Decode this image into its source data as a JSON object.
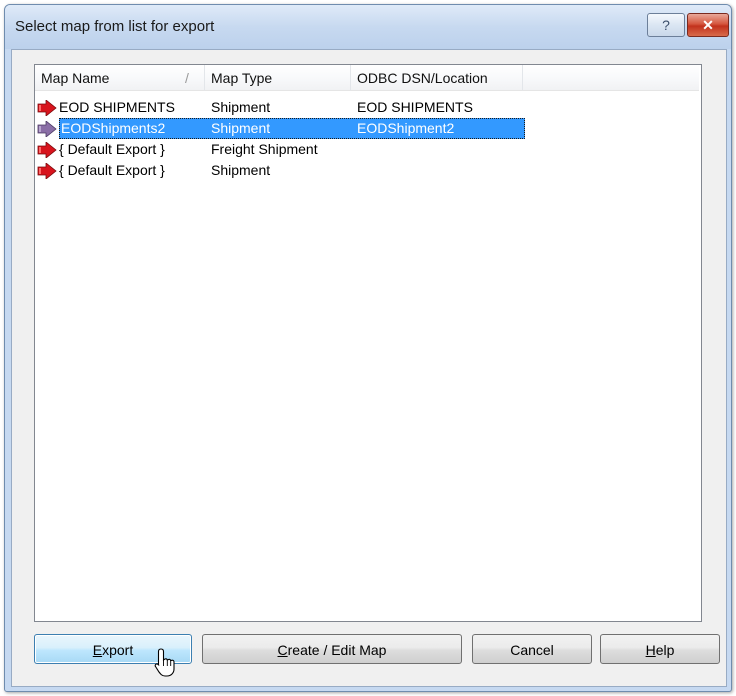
{
  "window": {
    "title": "Select map from list for export",
    "help_glyph": "?",
    "close_glyph": "✕"
  },
  "list": {
    "columns": [
      "Map Name",
      "Map Type",
      "ODBC DSN/Location"
    ],
    "sort_indicator": "/",
    "rows": [
      {
        "name": "EOD SHIPMENTS",
        "type": "Shipment",
        "location": "EOD SHIPMENTS",
        "selected": false,
        "icon": "red-export-arrow-icon"
      },
      {
        "name": "EODShipments2",
        "type": "Shipment",
        "location": "EODShipment2",
        "selected": true,
        "icon": "red-export-arrow-icon"
      },
      {
        "name": "{ Default Export }",
        "type": "Freight Shipment",
        "location": "",
        "selected": false,
        "icon": "red-export-arrow-icon"
      },
      {
        "name": "{ Default Export }",
        "type": "Shipment",
        "location": "",
        "selected": false,
        "icon": "red-export-arrow-icon"
      }
    ]
  },
  "buttons": {
    "export": {
      "accel": "E",
      "rest": "xport"
    },
    "create_edit": {
      "accel": "C",
      "rest": "reate / Edit Map"
    },
    "cancel": "Cancel",
    "help": {
      "accel": "H",
      "rest": "elp"
    }
  },
  "colors": {
    "selection": "#3399ff",
    "title_bar": "#c6d9f1",
    "close_button": "#c2321d"
  }
}
